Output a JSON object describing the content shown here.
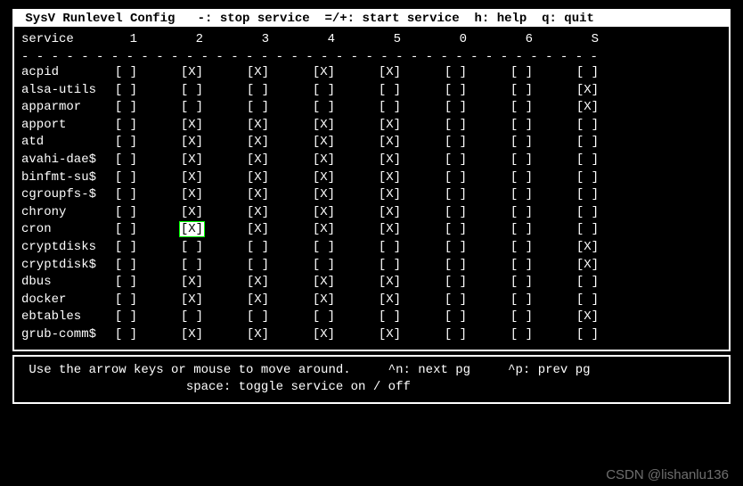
{
  "title": " SysV Runlevel Config   -: stop service  =/+: start service  h: help  q: quit ",
  "header": {
    "label": "service",
    "cols": [
      "1",
      "2",
      "3",
      "4",
      "5",
      "0",
      "6",
      "S"
    ]
  },
  "dashes": "- - - - - - - - - - - - - - - - - - - - - - - - - - - - - - - - - - - - - - - ",
  "cursor": {
    "row": 9,
    "col": 1
  },
  "services": [
    {
      "name": "acpid",
      "state": [
        "[ ]",
        "[X]",
        "[X]",
        "[X]",
        "[X]",
        "[ ]",
        "[ ]",
        "[ ]"
      ]
    },
    {
      "name": "alsa-utils",
      "state": [
        "[ ]",
        "[ ]",
        "[ ]",
        "[ ]",
        "[ ]",
        "[ ]",
        "[ ]",
        "[X]"
      ]
    },
    {
      "name": "apparmor",
      "state": [
        "[ ]",
        "[ ]",
        "[ ]",
        "[ ]",
        "[ ]",
        "[ ]",
        "[ ]",
        "[X]"
      ]
    },
    {
      "name": "apport",
      "state": [
        "[ ]",
        "[X]",
        "[X]",
        "[X]",
        "[X]",
        "[ ]",
        "[ ]",
        "[ ]"
      ]
    },
    {
      "name": "atd",
      "state": [
        "[ ]",
        "[X]",
        "[X]",
        "[X]",
        "[X]",
        "[ ]",
        "[ ]",
        "[ ]"
      ]
    },
    {
      "name": "avahi-dae$",
      "state": [
        "[ ]",
        "[X]",
        "[X]",
        "[X]",
        "[X]",
        "[ ]",
        "[ ]",
        "[ ]"
      ]
    },
    {
      "name": "binfmt-su$",
      "state": [
        "[ ]",
        "[X]",
        "[X]",
        "[X]",
        "[X]",
        "[ ]",
        "[ ]",
        "[ ]"
      ]
    },
    {
      "name": "cgroupfs-$",
      "state": [
        "[ ]",
        "[X]",
        "[X]",
        "[X]",
        "[X]",
        "[ ]",
        "[ ]",
        "[ ]"
      ]
    },
    {
      "name": "chrony",
      "state": [
        "[ ]",
        "[X]",
        "[X]",
        "[X]",
        "[X]",
        "[ ]",
        "[ ]",
        "[ ]"
      ]
    },
    {
      "name": "cron",
      "state": [
        "[ ]",
        "[X]",
        "[X]",
        "[X]",
        "[X]",
        "[ ]",
        "[ ]",
        "[ ]"
      ]
    },
    {
      "name": "cryptdisks",
      "state": [
        "[ ]",
        "[ ]",
        "[ ]",
        "[ ]",
        "[ ]",
        "[ ]",
        "[ ]",
        "[X]"
      ]
    },
    {
      "name": "cryptdisk$",
      "state": [
        "[ ]",
        "[ ]",
        "[ ]",
        "[ ]",
        "[ ]",
        "[ ]",
        "[ ]",
        "[X]"
      ]
    },
    {
      "name": "dbus",
      "state": [
        "[ ]",
        "[X]",
        "[X]",
        "[X]",
        "[X]",
        "[ ]",
        "[ ]",
        "[ ]"
      ]
    },
    {
      "name": "docker",
      "state": [
        "[ ]",
        "[X]",
        "[X]",
        "[X]",
        "[X]",
        "[ ]",
        "[ ]",
        "[ ]"
      ]
    },
    {
      "name": "ebtables",
      "state": [
        "[ ]",
        "[ ]",
        "[ ]",
        "[ ]",
        "[ ]",
        "[ ]",
        "[ ]",
        "[X]"
      ]
    },
    {
      "name": "grub-comm$",
      "state": [
        "[ ]",
        "[X]",
        "[X]",
        "[X]",
        "[X]",
        "[ ]",
        "[ ]",
        "[ ]"
      ]
    }
  ],
  "footer": {
    "line1": " Use the arrow keys or mouse to move around.     ^n: next pg     ^p: prev pg",
    "line2": "                      space: toggle service on / off"
  },
  "watermark": "CSDN @lishanlu136"
}
